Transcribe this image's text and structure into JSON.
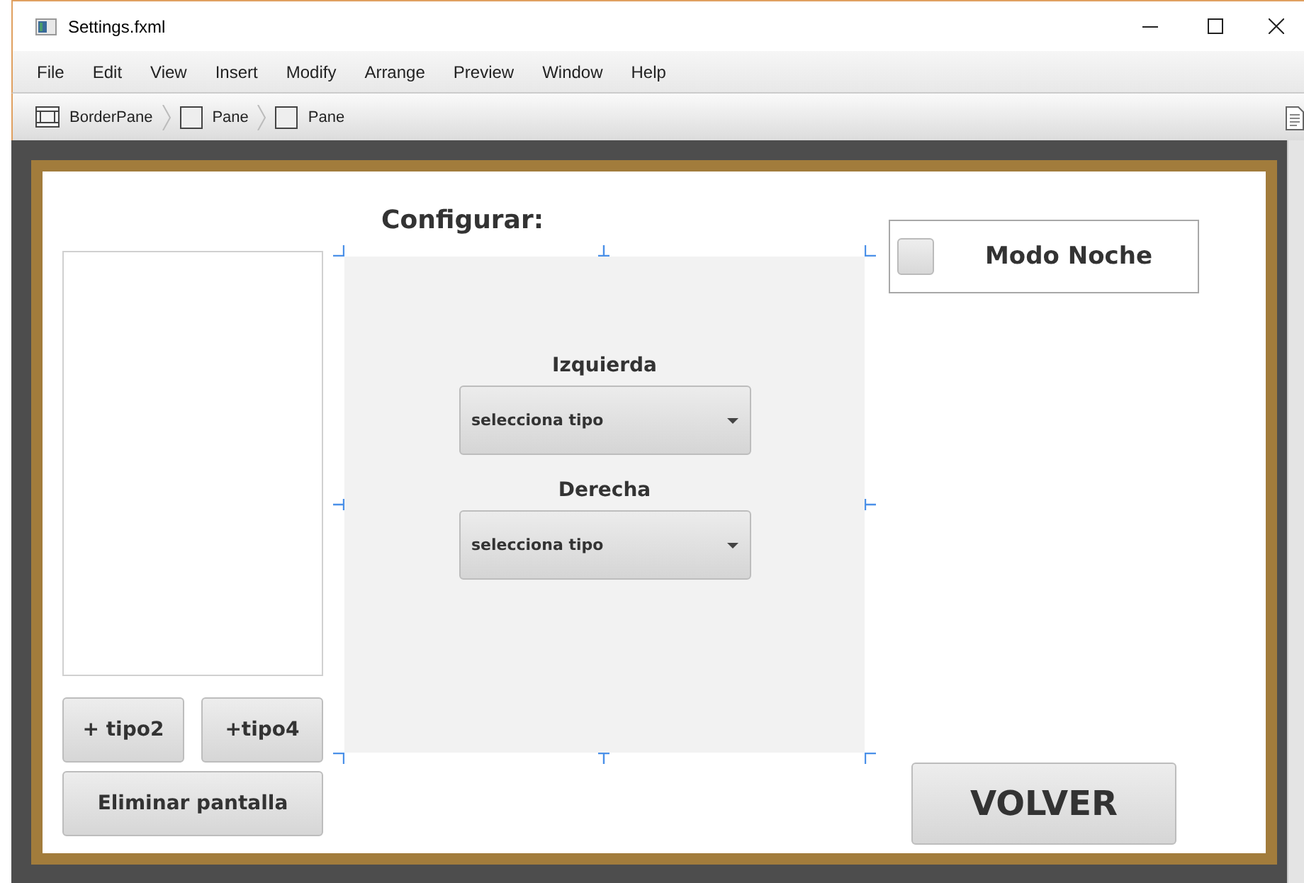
{
  "window": {
    "title": "Settings.fxml"
  },
  "menu": [
    "File",
    "Edit",
    "View",
    "Insert",
    "Modify",
    "Arrange",
    "Preview",
    "Window",
    "Help"
  ],
  "breadcrumbs": [
    {
      "label": "BorderPane",
      "kind": "border"
    },
    {
      "label": "Pane",
      "kind": "pane"
    },
    {
      "label": "Pane",
      "kind": "pane"
    }
  ],
  "canvas": {
    "heading": "Configurar:",
    "add_buttons": [
      "+ tipo2",
      "+tipo4"
    ],
    "remove_button": "Eliminar pantalla",
    "selectors": [
      {
        "label": "Izquierda",
        "value": "selecciona tipo"
      },
      {
        "label": "Derecha",
        "value": "selecciona tipo"
      }
    ],
    "night_mode": {
      "label": "Modo Noche",
      "checked": false
    },
    "back_button": "VOLVER"
  }
}
